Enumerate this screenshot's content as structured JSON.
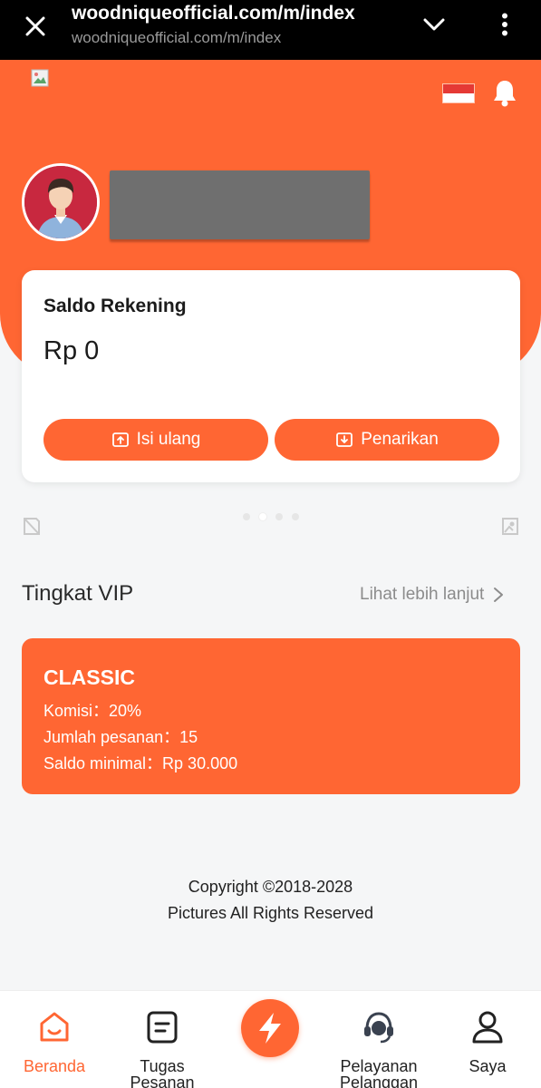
{
  "browser": {
    "title": "woodniqueofficial.com/m/index",
    "url": "woodniqueofficial.com/m/index"
  },
  "header": {
    "flag_colors": [
      "#e53935",
      "#ffffff"
    ],
    "accent_color": "#ff6633"
  },
  "balance": {
    "label": "Saldo Rekening",
    "amount": "Rp 0",
    "topup_label": "Isi ulang",
    "withdraw_label": "Penarikan"
  },
  "vip": {
    "title": "Tingkat VIP",
    "more_label": "Lihat lebih lanjut",
    "level": "CLASSIC",
    "commission": "Komisi：20%",
    "orders": "Jumlah pesanan：15",
    "min_balance": "Saldo minimal：Rp 30.000"
  },
  "footer": {
    "line1": "Copyright ©2018-2028",
    "line2": "Pictures All Rights Reserved"
  },
  "nav": {
    "home": "Beranda",
    "tasks": "Tugas Pesanan",
    "service": "Pelayanan Pelanggan",
    "me": "Saya"
  }
}
